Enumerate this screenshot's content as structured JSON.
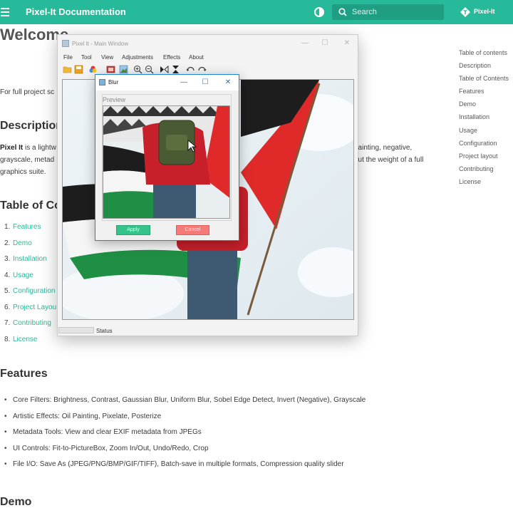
{
  "header": {
    "site_title": "Pixel-It Documentation",
    "search_placeholder": "Search",
    "repo_name": "Pixel-It",
    "accent_color": "#26b99a",
    "icons": [
      "menu-icon",
      "theme-toggle-icon",
      "search-icon",
      "repo-icon"
    ]
  },
  "page": {
    "welcome_heading": "Welcome",
    "intro_text": "For full project sc",
    "description_heading": "Description",
    "description_lines": [
      {
        "bold": "Pixel It",
        "rest": " is a lightw"
      },
      {
        "bold": "",
        "rest": "grayscale, metad"
      },
      {
        "bold": "",
        "rest": "graphics suite."
      }
    ],
    "description_right_lines": [
      "painting, negative,",
      "out the weight of a full"
    ],
    "toc_heading": "Table of Co",
    "toc_items": [
      {
        "num": "1.",
        "label": "Features"
      },
      {
        "num": "2.",
        "label": "Demo"
      },
      {
        "num": "3.",
        "label": "Installation"
      },
      {
        "num": "4.",
        "label": "Usage"
      },
      {
        "num": "5.",
        "label": "Configuration"
      },
      {
        "num": "6.",
        "label": "Project Layou"
      },
      {
        "num": "7.",
        "label": "Contributing"
      },
      {
        "num": "8.",
        "label": "License"
      }
    ],
    "features_heading": "Features",
    "features": [
      "Core Filters: Brightness, Contrast, Gaussian Blur, Uniform Blur, Sobel Edge Detect, Invert (Negative), Grayscale",
      "Artistic Effects: Oil Painting, Pixelate, Posterize",
      "Metadata Tools: View and clear EXIF metadata from JPEGs",
      "UI Controls: Fit-to-PictureBox, Zoom In/Out, Undo/Redo, Crop",
      "File I/O: Save As (JPEG/PNG/BMP/GIF/TIFF), Batch-save in multiple formats, Compression quality slider"
    ],
    "demo_heading": "Demo"
  },
  "right_toc": {
    "items": [
      "Table of contents",
      "Description",
      "Table of Contents",
      "Features",
      "Demo",
      "Installation",
      "Usage",
      "Configuration",
      "Project layout",
      "Contributing",
      "License"
    ]
  },
  "app_window": {
    "title": "Pixel It - Main Window",
    "menu": [
      "File",
      "Tool",
      "View",
      "Adjustments",
      "Effects",
      "About"
    ],
    "toolbar_icons": [
      "open-icon",
      "save-icon",
      "color-wheel-icon",
      "image-info-icon",
      "crop-icon",
      "zoom-in-icon",
      "zoom-out-icon",
      "flip-horizontal-icon",
      "flip-vertical-icon",
      "undo-icon",
      "redo-icon"
    ],
    "status_text": "Status"
  },
  "blur_dialog": {
    "title": "Blur",
    "preview_label": "Preview",
    "apply_label": "Apply",
    "cancel_label": "Cancel",
    "apply_color": "#36c28b",
    "cancel_color": "#f57a78"
  }
}
